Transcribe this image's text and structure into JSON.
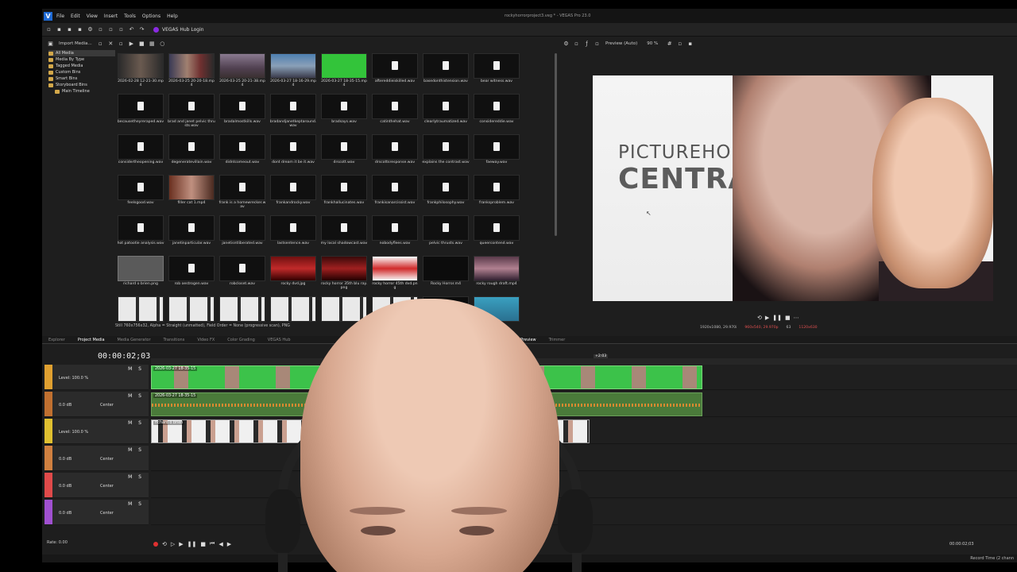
{
  "window": {
    "title": "rockyhorrorproject3.veg * - VEGAS Pro 23.0"
  },
  "menu": [
    "File",
    "Edit",
    "View",
    "Insert",
    "Tools",
    "Options",
    "Help"
  ],
  "toolbar": {
    "hub_label": "VEGAS Hub Login"
  },
  "media": {
    "import_label": "Import Media...",
    "tree": [
      "All Media",
      "Media By Type",
      "Tagged Media",
      "Custom Bins",
      "Smart Bins",
      "Storyboard Bins",
      "Main Timeline"
    ],
    "files": [
      {
        "name": "2026-02-28 12-21-30.mp4",
        "kind": "vid1"
      },
      {
        "name": "2026-03-25 20-20-18.mp4",
        "kind": "vid2"
      },
      {
        "name": "2026-03-25 20-21-38.mp4",
        "kind": "vid3"
      },
      {
        "name": "2026-03-27 18-16-29.mp4",
        "kind": "vid4"
      },
      {
        "name": "2026-03-27 18-35-15.mp4",
        "kind": "vid5"
      },
      {
        "name": "aftereddieiskilled.wav",
        "kind": "audio"
      },
      {
        "name": "basedonthistension.wav",
        "kind": "audio"
      },
      {
        "name": "bear witness.wav",
        "kind": "audio"
      },
      {
        "name": "becausetheyreraped.wav",
        "kind": "audio"
      },
      {
        "name": "brad and janet pelvic thrusts.wav",
        "kind": "audio"
      },
      {
        "name": "bradalmostkills.wav",
        "kind": "audio"
      },
      {
        "name": "bradandjanetkeptaround.wav",
        "kind": "audio"
      },
      {
        "name": "bradsays.wav",
        "kind": "audio"
      },
      {
        "name": "catinthehat.wav",
        "kind": "audio"
      },
      {
        "name": "clearlytraumatized.wav",
        "kind": "audio"
      },
      {
        "name": "considereddie.wav",
        "kind": "audio"
      },
      {
        "name": "considertheopening.wav",
        "kind": "audio"
      },
      {
        "name": "degeneratevillain.wav",
        "kind": "audio"
      },
      {
        "name": "didntcomeout.wav",
        "kind": "audio"
      },
      {
        "name": "dont dream it be it.wav",
        "kind": "audio"
      },
      {
        "name": "drscott.wav",
        "kind": "audio"
      },
      {
        "name": "drscottsresponse.wav",
        "kind": "audio"
      },
      {
        "name": "explains the contrast.wav",
        "kind": "audio"
      },
      {
        "name": "faeway.wav",
        "kind": "audio"
      },
      {
        "name": "feelsgood.wav",
        "kind": "audio"
      },
      {
        "name": "filler cat 1.mp4",
        "kind": "cat"
      },
      {
        "name": "frank is a homewrecker.wav",
        "kind": "audio"
      },
      {
        "name": "frankandrocky.wav",
        "kind": "audio"
      },
      {
        "name": "frankhallucinates.wav",
        "kind": "audio"
      },
      {
        "name": "frankisanarcissist.wav",
        "kind": "audio"
      },
      {
        "name": "frankphilosophy.wav",
        "kind": "audio"
      },
      {
        "name": "franksproblem.wav",
        "kind": "audio"
      },
      {
        "name": "hot patootie analysis.wav",
        "kind": "audio"
      },
      {
        "name": "janetinparticular.wav",
        "kind": "audio"
      },
      {
        "name": "janetisntliberated.wav",
        "kind": "audio"
      },
      {
        "name": "lastsentence.wav",
        "kind": "audio"
      },
      {
        "name": "my local shadowcast.wav",
        "kind": "audio"
      },
      {
        "name": "nobodyflees.wav",
        "kind": "audio"
      },
      {
        "name": "pelvic thrusts.wav",
        "kind": "audio"
      },
      {
        "name": "queercontend.wav",
        "kind": "audio"
      },
      {
        "name": "richard o brien.png",
        "kind": "png1",
        "selected": true
      },
      {
        "name": "rob oestrogen.wav",
        "kind": "audio"
      },
      {
        "name": "robcloset.wav",
        "kind": "audio"
      },
      {
        "name": "rocky dvd.jpg",
        "kind": "dvd1"
      },
      {
        "name": "rocky horror 35th blu ray.png",
        "kind": "dvd2"
      },
      {
        "name": "rocky horror 45th dvd.png",
        "kind": "dvd3"
      },
      {
        "name": "Rocky Horror.m4",
        "kind": "blank"
      },
      {
        "name": "rocky rough draft.mp4",
        "kind": "rough"
      },
      {
        "name": "",
        "kind": "strip"
      },
      {
        "name": "",
        "kind": "strip"
      },
      {
        "name": "",
        "kind": "strip"
      },
      {
        "name": "",
        "kind": "strip"
      },
      {
        "name": "",
        "kind": "strip"
      },
      {
        "name": "",
        "kind": "strip"
      },
      {
        "name": "",
        "kind": "blank"
      },
      {
        "name": "",
        "kind": "teal"
      }
    ],
    "status": "Still 760x756x32, Alpha = Straight (unmatted), Field Order = None (progressive scan), PNG"
  },
  "preview": {
    "mode_label": "Preview (Auto)",
    "zoom": "90 %",
    "text_line1": "PICTUREHO",
    "text_line2": "CENTRA",
    "project_res": "1920x1080, 29.970i",
    "preview_res": "960x540, 29.970p",
    "frame": "63",
    "display": "1120x630"
  },
  "tabs": [
    {
      "label": "Explorer",
      "active": false
    },
    {
      "label": "Project Media",
      "active": true
    },
    {
      "label": "Media Generator",
      "active": false
    },
    {
      "label": "Transitions",
      "active": false
    },
    {
      "label": "Video FX",
      "active": false
    },
    {
      "label": "Color Grading",
      "active": false
    },
    {
      "label": "VEGAS Hub",
      "active": false
    },
    {
      "label": "Video Preview",
      "active": true
    },
    {
      "label": "Trimmer",
      "active": false
    }
  ],
  "timeline": {
    "timecode": "00:00:02;03",
    "marker_time": "+2:03",
    "tracks": [
      {
        "kind": "video",
        "color": "#e0a030",
        "level": "Level: 100.0 %",
        "pan": ""
      },
      {
        "kind": "audio",
        "color": "#c07030",
        "level": "0.0 dB",
        "pan": "Center"
      },
      {
        "kind": "video",
        "color": "#e0c030",
        "level": "Level: 100.0 %",
        "pan": ""
      },
      {
        "kind": "audio",
        "color": "#d08040",
        "level": "0.0 dB",
        "pan": "Center"
      },
      {
        "kind": "audio",
        "color": "#e04a4a",
        "level": "0.0 dB",
        "pan": "Center"
      },
      {
        "kind": "audio",
        "color": "#a050d0",
        "level": "0.0 dB",
        "pan": "Center"
      }
    ],
    "clip_video_label": "2026-03-27 18-35-15",
    "clip_audio_label": "2026-03-27 18-35-15",
    "clip_people_label": "richard o brien",
    "ms_label": "M S",
    "rate": "Rate: 0.00",
    "end_time": "00:00:02;03",
    "record_time": "Record Time (2 chann"
  }
}
